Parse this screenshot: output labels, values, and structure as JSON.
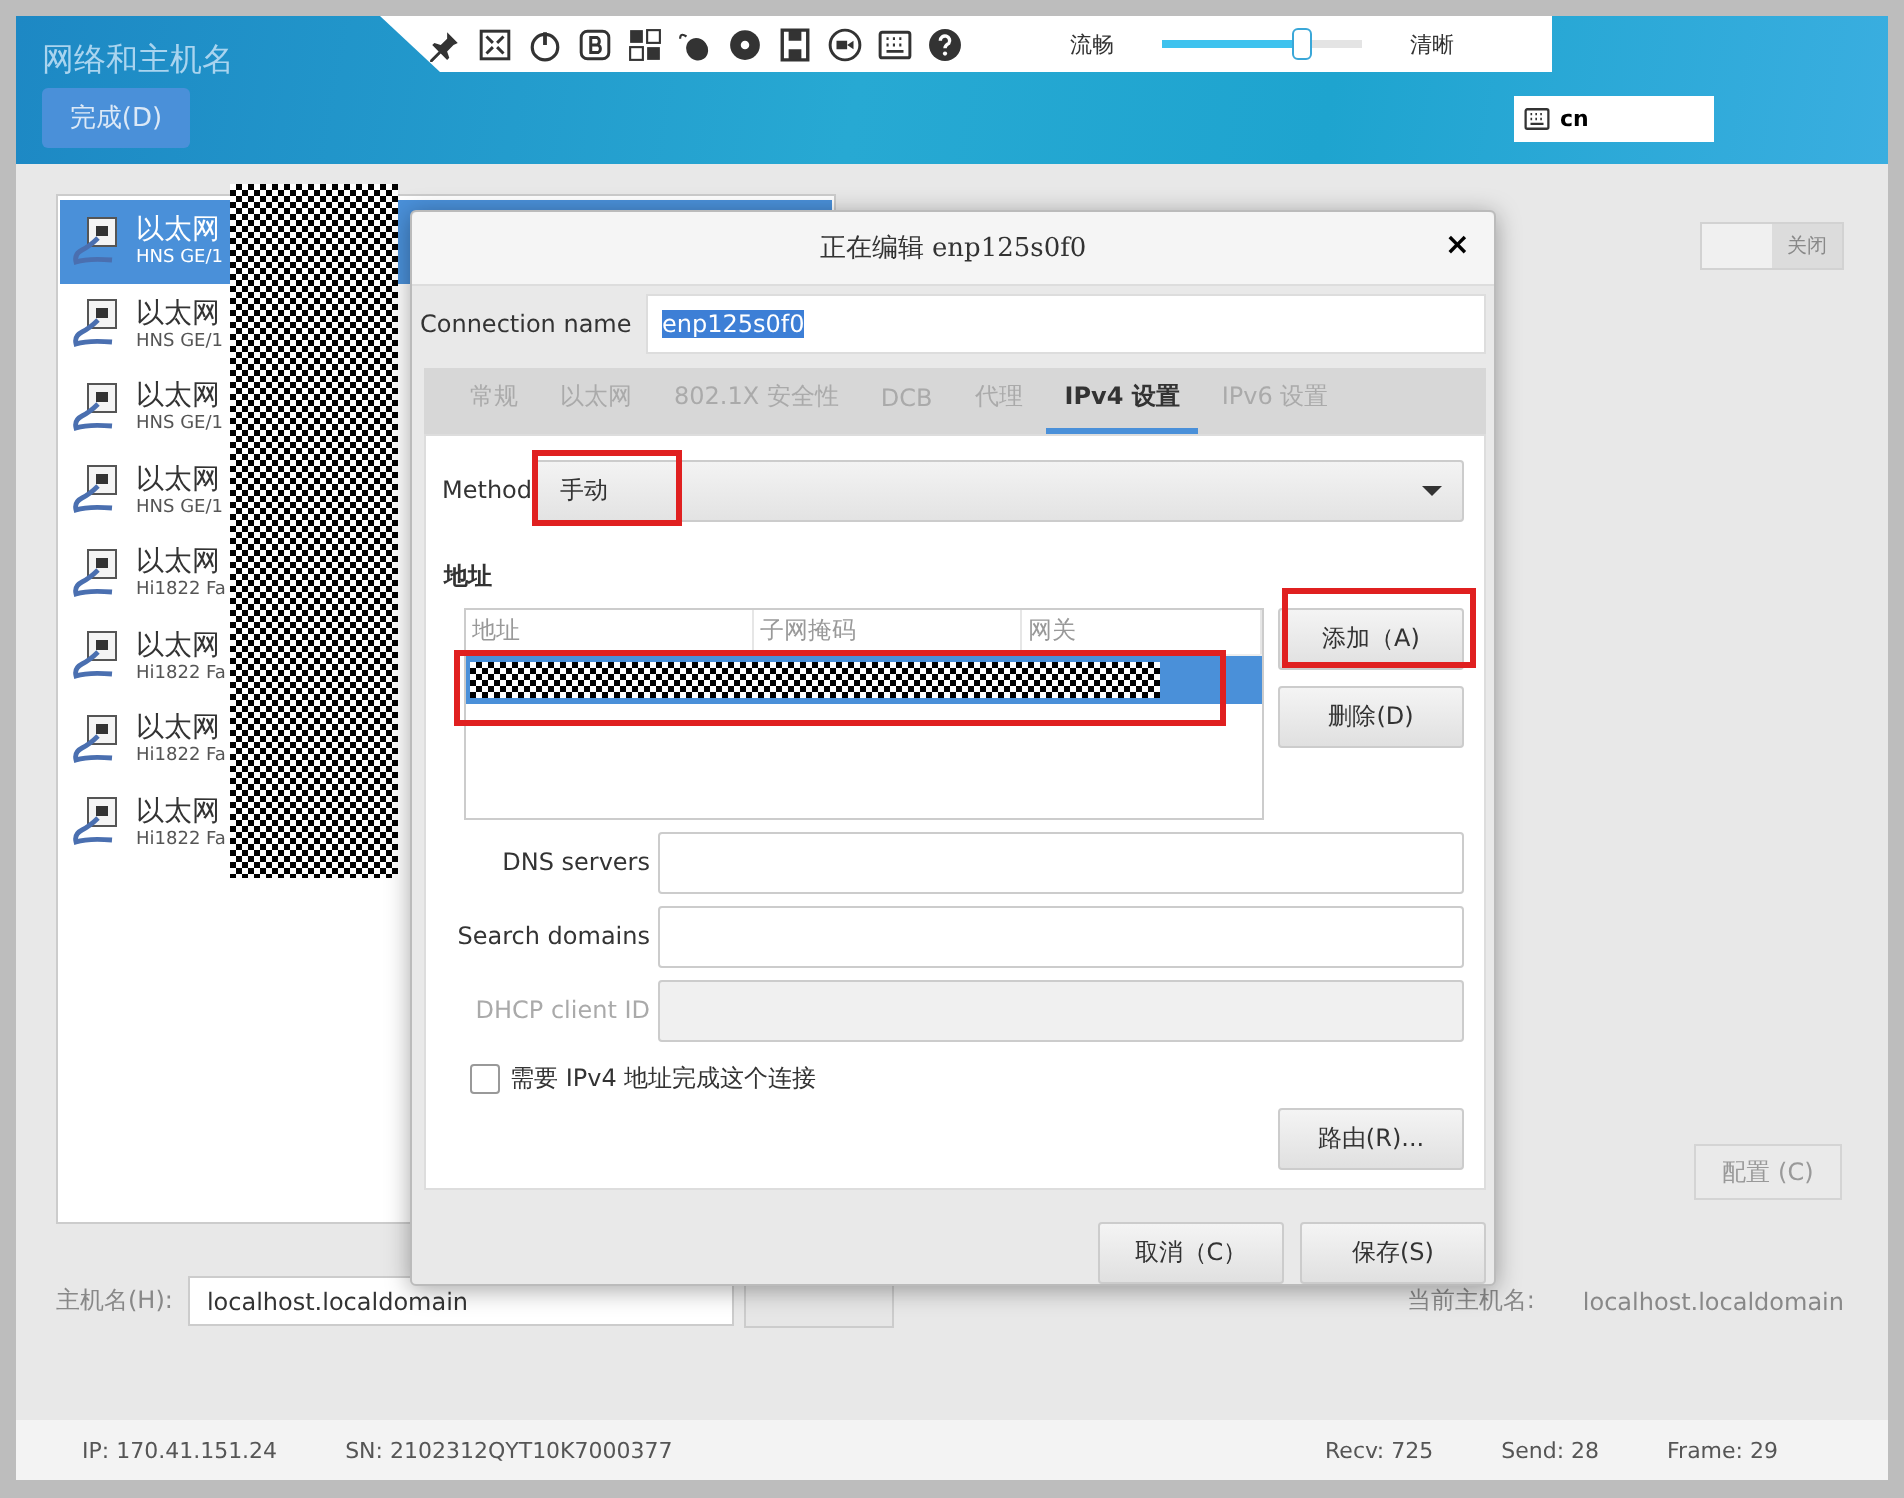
{
  "header": {
    "title": "网络和主机名",
    "done_button": "完成(D)",
    "keyboard_layout": "cn"
  },
  "remote_toolbar": {
    "quality_low": "流畅",
    "quality_high": "清晰",
    "quality": {
      "level": 0.7
    }
  },
  "connections": [
    {
      "name": "以太网",
      "detail": "HNS GE/1",
      "selected": true
    },
    {
      "name": "以太网",
      "detail": "HNS GE/1",
      "selected": false
    },
    {
      "name": "以太网",
      "detail": "HNS GE/1",
      "selected": false
    },
    {
      "name": "以太网",
      "detail": "HNS GE/1",
      "selected": false
    },
    {
      "name": "以太网",
      "detail": "Hi1822 Fa",
      "selected": false
    },
    {
      "name": "以太网",
      "detail": "Hi1822 Fa",
      "selected": false
    },
    {
      "name": "以太网",
      "detail": "Hi1822 Fa",
      "selected": false
    },
    {
      "name": "以太网",
      "detail": "Hi1822 Fa",
      "selected": false
    }
  ],
  "connection_toggle": {
    "label": "关闭",
    "on": false
  },
  "configure_button": "配置 (C)",
  "hostname": {
    "label": "主机名(H):",
    "value": "localhost.localdomain",
    "current_label": "当前主机名:",
    "current_value": "localhost.localdomain"
  },
  "dialog": {
    "title": "正在编辑 enp125s0f0",
    "close": "×",
    "connection_name_label": "Connection name",
    "connection_name": "enp125s0f0",
    "tabs": [
      {
        "label": "常规",
        "selected": false
      },
      {
        "label": "以太网",
        "selected": false
      },
      {
        "label": "802.1X 安全性",
        "selected": false
      },
      {
        "label": "DCB",
        "selected": false
      },
      {
        "label": "代理",
        "selected": false
      },
      {
        "label": "IPv4 设置",
        "selected": true
      },
      {
        "label": "IPv6 设置",
        "selected": false
      }
    ],
    "method_label": "Method",
    "method": "手动",
    "addresses_label": "地址",
    "address_columns": [
      "地址",
      "子网掩码",
      "网关"
    ],
    "add_button": "添加（A)",
    "delete_button": "删除(D)",
    "fields": [
      {
        "label": "DNS servers",
        "disabled": false
      },
      {
        "label": "Search domains",
        "disabled": false
      },
      {
        "label": "DHCP client ID",
        "disabled": true
      }
    ],
    "require_ipv4": {
      "label": "需要 IPv4 地址完成这个连接",
      "checked": false
    },
    "routes_button": "路由(R)...",
    "cancel_button": "取消（C）",
    "save_button": "保存(S)"
  },
  "status_bar": {
    "ip": "IP: 170.41.151.24",
    "sn": "SN: 2102312QYT10K7000377",
    "recv": "Recv: 725",
    "send": "Send: 28",
    "frame": "Frame: 29"
  }
}
